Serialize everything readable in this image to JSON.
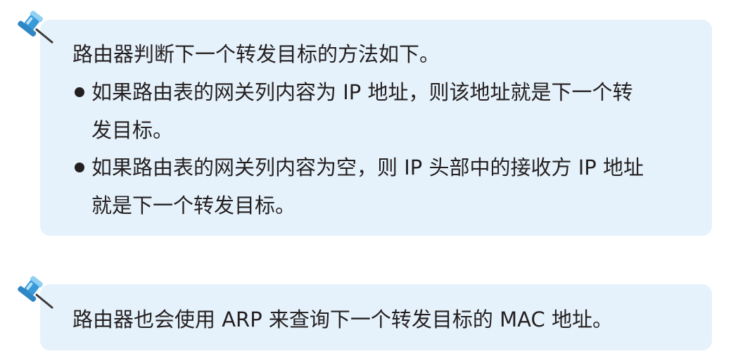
{
  "note1": {
    "intro": "路由器判断下一个转发目标的方法如下。",
    "bullets": [
      {
        "line1": "如果路由表的网关列内容为 IP 地址，则该地址就是下一个转",
        "line2": "发目标。"
      },
      {
        "line1": "如果路由表的网关列内容为空，则 IP 头部中的接收方 IP 地址",
        "line2": "就是下一个转发目标。"
      }
    ]
  },
  "note2": {
    "text": "路由器也会使用 ARP 来查询下一个转发目标的 MAC 地址。"
  },
  "colors": {
    "note_background": "#e6f2fb",
    "pin_blue": "#3a9ad9",
    "pin_light": "#8fd0f3",
    "text": "#231f20"
  },
  "icons": {
    "pin": "pushpin-icon"
  }
}
